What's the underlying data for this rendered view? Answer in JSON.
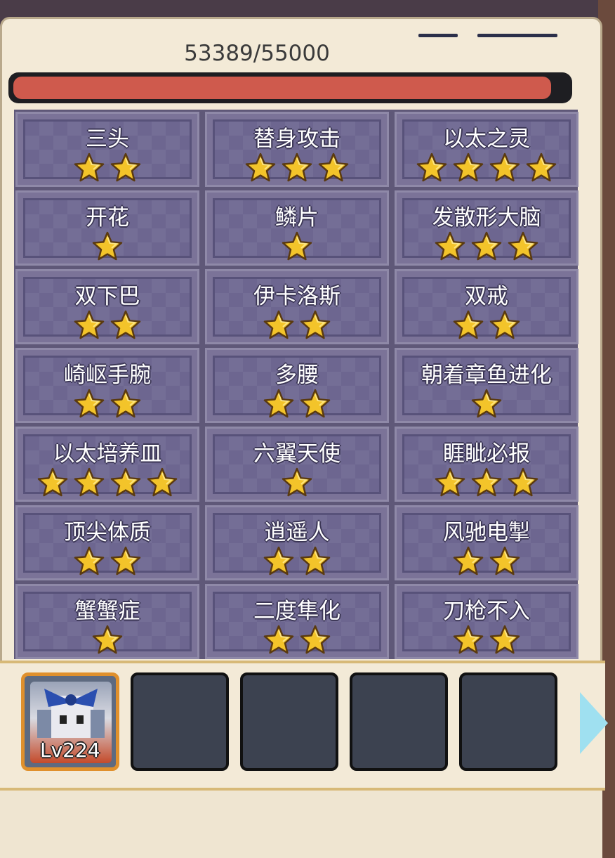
{
  "hp": {
    "current": 53389,
    "max": 55000,
    "label": "53389/55000"
  },
  "skills": [
    {
      "name": "三头",
      "stars": 2
    },
    {
      "name": "替身攻击",
      "stars": 3
    },
    {
      "name": "以太之灵",
      "stars": 4
    },
    {
      "name": "开花",
      "stars": 1
    },
    {
      "name": "鳞片",
      "stars": 1
    },
    {
      "name": "发散形大脑",
      "stars": 3
    },
    {
      "name": "双下巴",
      "stars": 2
    },
    {
      "name": "伊卡洛斯",
      "stars": 2
    },
    {
      "name": "双戒",
      "stars": 2
    },
    {
      "name": "崎岖手腕",
      "stars": 2
    },
    {
      "name": "多腰",
      "stars": 2
    },
    {
      "name": "朝着章鱼进化",
      "stars": 1
    },
    {
      "name": "以太培养皿",
      "stars": 4
    },
    {
      "name": "六翼天使",
      "stars": 1
    },
    {
      "name": "睚眦必报",
      "stars": 3
    },
    {
      "name": "顶尖体质",
      "stars": 2
    },
    {
      "name": "逍遥人",
      "stars": 2
    },
    {
      "name": "风驰电掣",
      "stars": 2
    },
    {
      "name": "蟹蟹症",
      "stars": 1
    },
    {
      "name": "二度隼化",
      "stars": 2
    },
    {
      "name": "刀枪不入",
      "stars": 2
    }
  ],
  "team": {
    "hero_level": "Lv224",
    "empty_slots": 4
  },
  "colors": {
    "hp_fill": "#cf5a4d",
    "star": "#f3c42a",
    "slot_border": "#e0902c"
  },
  "icons": {
    "star": "star-icon",
    "next": "arrow-right-icon"
  }
}
